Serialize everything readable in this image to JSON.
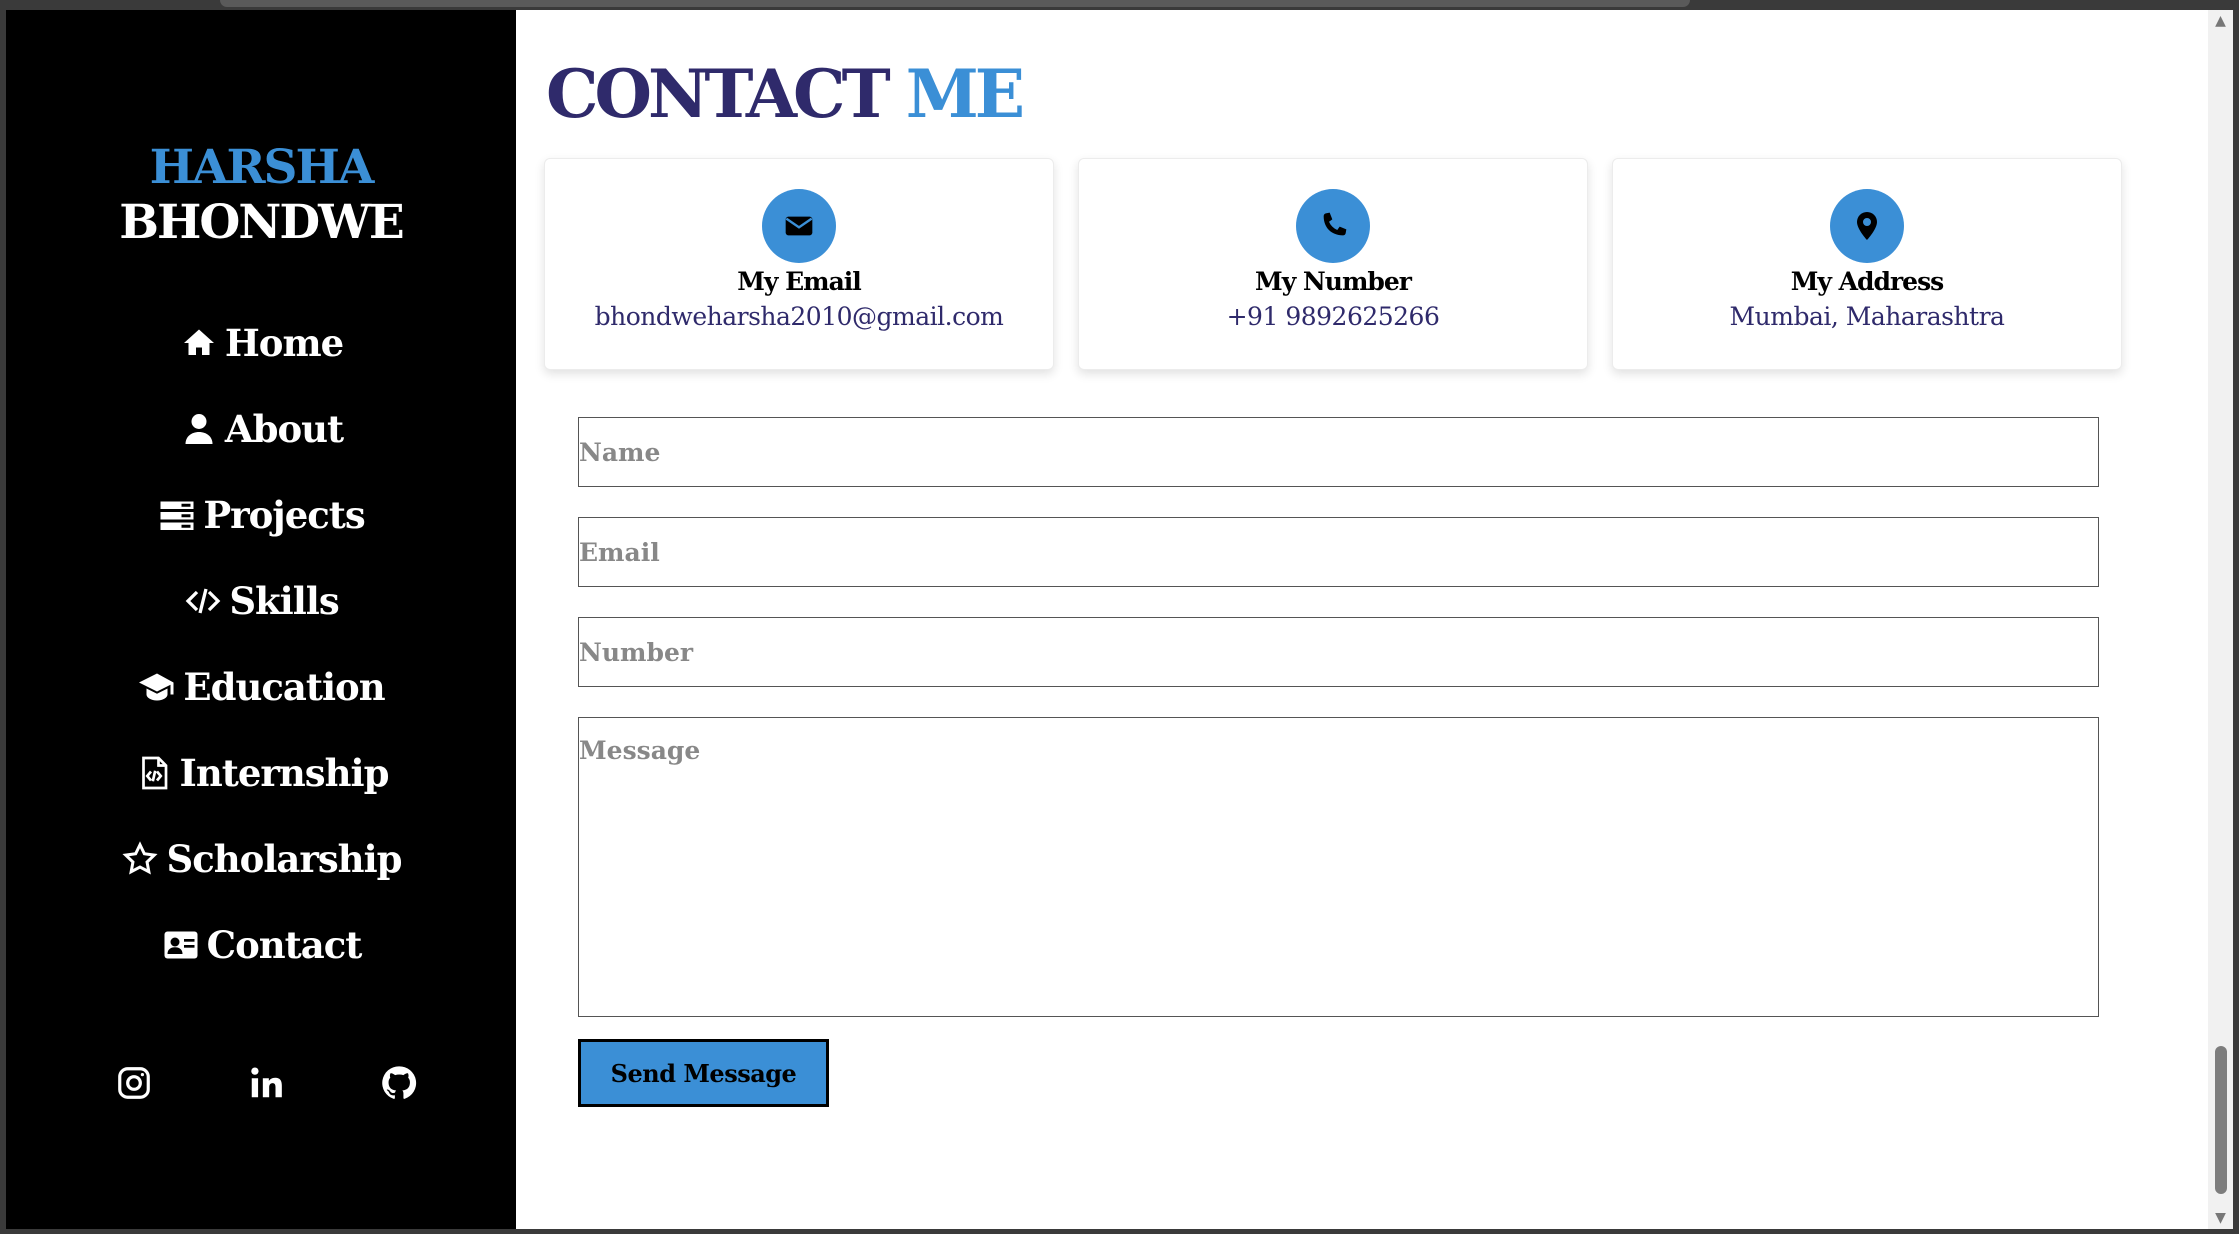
{
  "brand": {
    "first": "HARSHA",
    "last": "BHONDWE"
  },
  "nav": [
    {
      "label": "Home",
      "icon": "home-icon"
    },
    {
      "label": "About",
      "icon": "user-icon"
    },
    {
      "label": "Projects",
      "icon": "server-icon"
    },
    {
      "label": "Skills",
      "icon": "code-icon"
    },
    {
      "label": "Education",
      "icon": "graduation-cap-icon"
    },
    {
      "label": "Internship",
      "icon": "file-code-icon"
    },
    {
      "label": "Scholarship",
      "icon": "star-icon"
    },
    {
      "label": "Contact",
      "icon": "address-card-icon"
    }
  ],
  "socials": [
    "instagram-icon",
    "linkedin-icon",
    "github-icon"
  ],
  "heading": {
    "main": "CONTACT",
    "accent": "ME"
  },
  "cards": [
    {
      "title": "My Email",
      "value": "bhondweharsha2010@gmail.com",
      "icon": "envelope-icon"
    },
    {
      "title": "My Number",
      "value": "+91 9892625266",
      "icon": "phone-icon"
    },
    {
      "title": "My Address",
      "value": "Mumbai, Maharashtra",
      "icon": "map-pin-icon"
    }
  ],
  "form": {
    "name_placeholder": "Name",
    "email_placeholder": "Email",
    "number_placeholder": "Number",
    "message_placeholder": "Message",
    "submit_label": "Send Message"
  },
  "colors": {
    "accent": "#3b8fd6",
    "heading": "#2f2a6b",
    "sidebar_bg": "#000000"
  }
}
